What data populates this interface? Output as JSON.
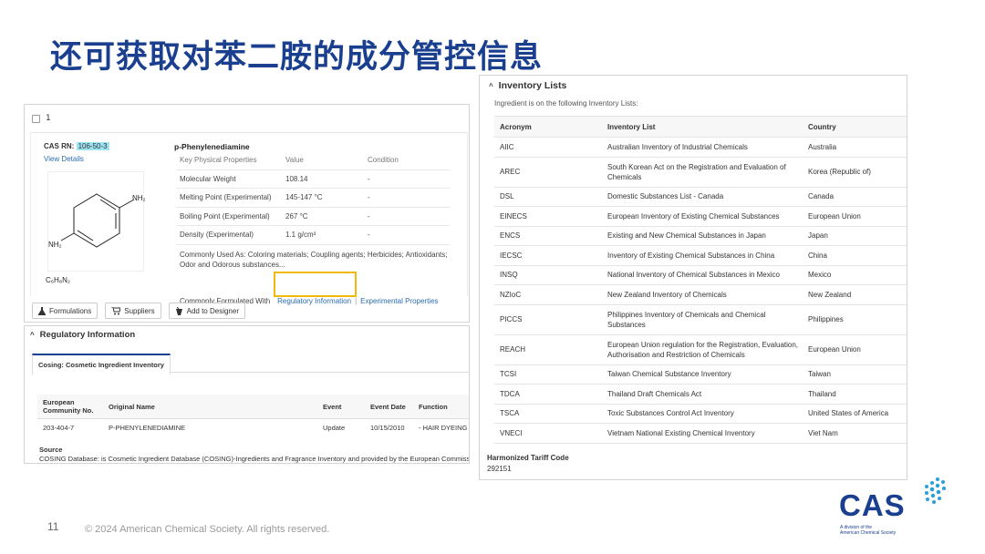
{
  "slide": {
    "title": "还可获取对苯二胺的成分管控信息",
    "page_number": "11",
    "copyright": "© 2024 American Chemical Society. All rights reserved."
  },
  "result": {
    "index": "1",
    "cas_label": "CAS RN:",
    "cas_number": "106-50-3",
    "view_details": "View Details",
    "formula": "C₆H₈N₂",
    "structure_labels": {
      "amine_top": "NH₂",
      "amine_bottom": "NH₂"
    },
    "compound_name": "p-Phenylenediamine",
    "props_headers": [
      "Key Physical Properties",
      "Value",
      "Condition"
    ],
    "props": [
      {
        "name": "Molecular Weight",
        "value": "108.14",
        "condition": "-"
      },
      {
        "name": "Melting Point (Experimental)",
        "value": "145-147 °C",
        "condition": "-"
      },
      {
        "name": "Boiling Point (Experimental)",
        "value": "267 °C",
        "condition": "-"
      },
      {
        "name": "Density (Experimental)",
        "value": "1.1 g/cm³",
        "condition": "-"
      }
    ],
    "commonly_used_as": "Commonly Used As:  Coloring materials; Coupling agents; Herbicides; Antioxidants; Odor and Odorous substances...",
    "links": {
      "formulated_with": "Commonly Formulated With",
      "regulatory": "Regulatory Information",
      "experimental": "Experimental Properties",
      "separator": "|"
    },
    "buttons": {
      "formulations": "Formulations",
      "suppliers": "Suppliers",
      "add_to_designer": "Add to Designer"
    }
  },
  "regulatory": {
    "title": "Regulatory Information",
    "tab": "Cosing: Cosmetic Ingredient Inventory",
    "headers": [
      "European Community No.",
      "Original Name",
      "Event",
      "Event Date",
      "Function"
    ],
    "rows": [
      [
        "203-404-7",
        "P-PHENYLENEDIAMINE",
        "Update",
        "10/15/2010",
        "- HAIR DYEING"
      ]
    ],
    "source_label": "Source",
    "source_text": "COSING Database: is Cosmetic Ingredient Database (COSING)-Ingredients and Fragrance Inventory and provided by the European Commission."
  },
  "inventory": {
    "title": "Inventory Lists",
    "subtitle": "Ingredient is on the following Inventory Lists:",
    "headers": [
      "Acronym",
      "Inventory List",
      "Country"
    ],
    "rows": [
      [
        "AIIC",
        "Australian Inventory of Industrial Chemicals",
        "Australia"
      ],
      [
        "AREC",
        "South Korean Act on the Registration and Evaluation of Chemicals",
        "Korea (Republic of)"
      ],
      [
        "DSL",
        "Domestic Substances List - Canada",
        "Canada"
      ],
      [
        "EINECS",
        "European Inventory of Existing Chemical Substances",
        "European Union"
      ],
      [
        "ENCS",
        "Existing and New Chemical Substances in Japan",
        "Japan"
      ],
      [
        "IECSC",
        "Inventory of Existing Chemical Substances in China",
        "China"
      ],
      [
        "INSQ",
        "National Inventory of Chemical Substances in Mexico",
        "Mexico"
      ],
      [
        "NZIoC",
        "New Zealand Inventory of Chemicals",
        "New Zealand"
      ],
      [
        "PICCS",
        "Philippines Inventory of Chemicals and Chemical Substances",
        "Philippines"
      ],
      [
        "REACH",
        "European Union regulation for the Registration, Evaluation, Authorisation and Restriction of Chemicals",
        "European Union"
      ],
      [
        "TCSI",
        "Taiwan Chemical Substance Inventory",
        "Taiwan"
      ],
      [
        "TDCA",
        "Thailand Draft Chemicals Act",
        "Thailand"
      ],
      [
        "TSCA",
        "Toxic Substances Control Act Inventory",
        "United States of America"
      ],
      [
        "VNECI",
        "Vietnam National Existing Chemical Inventory",
        "Viet Nam"
      ]
    ],
    "hts_label": "Harmonized Tariff Code",
    "hts_value": "292151"
  },
  "logo": {
    "text": "CAS",
    "sub_line1": "A division of the",
    "sub_line2": "American Chemical Society"
  },
  "colors": {
    "title_blue": "#1a3f8f",
    "highlight": "#f2b90d",
    "link_blue": "#2b6cb0",
    "cas_highlight": "#9de3f1"
  }
}
